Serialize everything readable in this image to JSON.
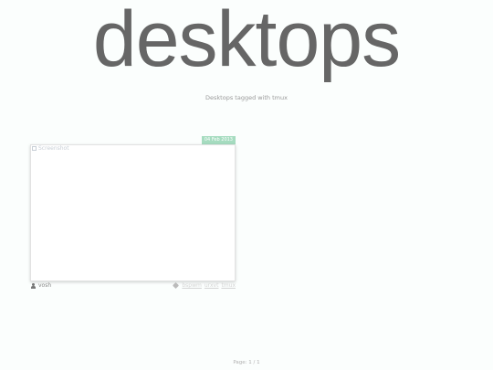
{
  "header": {
    "site_title": "desktops",
    "subtitle": "Desktops tagged with tmux"
  },
  "desktop_card": {
    "date": "04 Feb 2013",
    "screenshot_alt": "Screenshot",
    "user": "vosh",
    "tags": [
      "bspwm",
      "urxvt",
      "tmux"
    ]
  },
  "pagination": {
    "text": "Page: 1 / 1"
  },
  "colors": {
    "background": "#fbfefd",
    "badge": "#a6dcc0",
    "title": "#666666"
  }
}
